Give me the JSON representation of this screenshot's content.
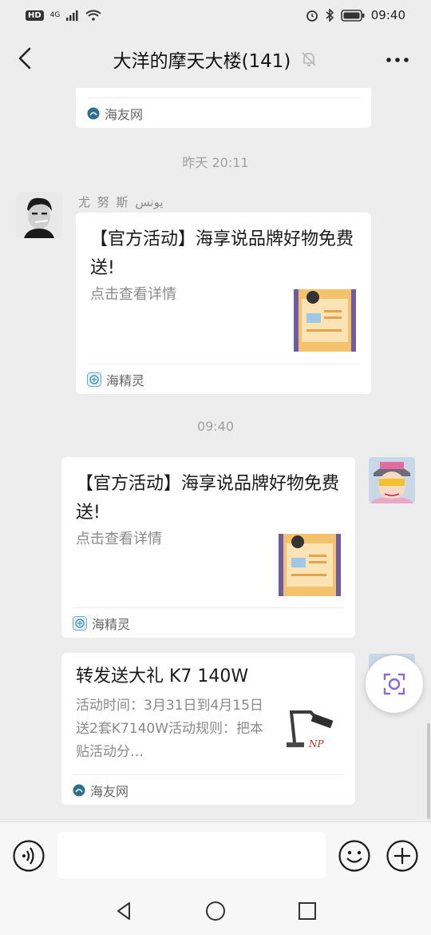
{
  "status": {
    "left_icons": "4G signal wifi",
    "hd": "HD",
    "net": "4G",
    "time": "09:40"
  },
  "header": {
    "title": "大洋的摩天大楼(141)"
  },
  "messages": {
    "top_card": {
      "source": "海友网"
    },
    "ts1": "昨天 20:11",
    "msg1": {
      "sender": "尤 努 斯  يونس",
      "title": "【官方活动】海享说品牌好物免费送!",
      "desc": "点击查看详情",
      "source": "海精灵"
    },
    "ts2": "09:40",
    "msg2": {
      "title": "【官方活动】海享说品牌好物免费送!",
      "desc": "点击查看详情",
      "source": "海精灵"
    },
    "msg3": {
      "title": "转发送大礼 K7 140W",
      "desc": "活动时间：3月31日到4月15日送2套K7140W活动规则：把本贴活动分…",
      "source": "海友网"
    }
  },
  "colors": {
    "bg": "#ededed",
    "card": "#ffffff",
    "accent": "#7b5cd6"
  },
  "icons": {
    "back": "back-arrow-icon",
    "mute": "bell-off-icon",
    "more": "more-dots-icon",
    "voice": "voice-icon",
    "emoji": "emoji-icon",
    "plus": "plus-icon",
    "scan": "scan-icon"
  }
}
